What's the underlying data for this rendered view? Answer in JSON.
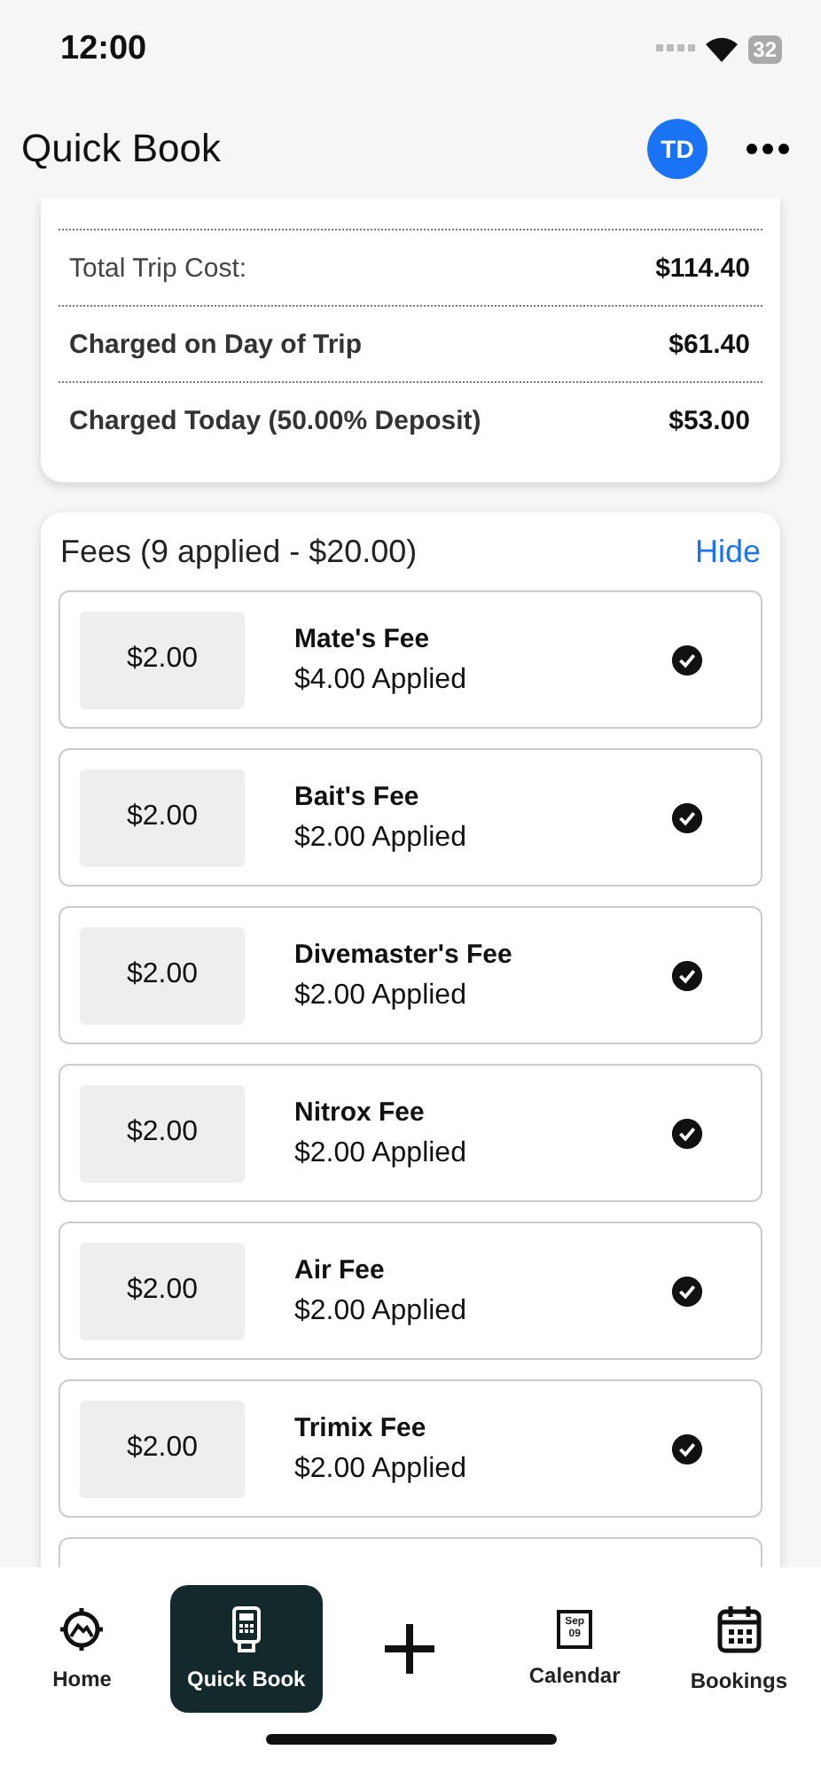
{
  "status_bar": {
    "time": "12:00",
    "battery": "32"
  },
  "header": {
    "title": "Quick Book",
    "avatar": "TD"
  },
  "summary": {
    "rows": [
      {
        "label": "Total Trip Cost:",
        "value": "$114.40",
        "kind": "plain"
      },
      {
        "label": "Charged on Day of Trip",
        "value": "$61.40",
        "kind": "bold"
      },
      {
        "label": "Charged Today (50.00% Deposit)",
        "value": "$53.00",
        "kind": "bold"
      }
    ]
  },
  "fees": {
    "title": "Fees (9 applied - $20.00)",
    "toggle": "Hide",
    "items": [
      {
        "price": "$2.00",
        "name": "Mate's Fee",
        "applied": "$4.00 Applied",
        "checked": true
      },
      {
        "price": "$2.00",
        "name": "Bait's Fee",
        "applied": "$2.00 Applied",
        "checked": true
      },
      {
        "price": "$2.00",
        "name": "Divemaster's Fee",
        "applied": "$2.00 Applied",
        "checked": true
      },
      {
        "price": "$2.00",
        "name": "Nitrox Fee",
        "applied": "$2.00 Applied",
        "checked": true
      },
      {
        "price": "$2.00",
        "name": "Air Fee",
        "applied": "$2.00 Applied",
        "checked": true
      },
      {
        "price": "$2.00",
        "name": "Trimix Fee",
        "applied": "$2.00 Applied",
        "checked": true
      }
    ]
  },
  "tab_bar": {
    "tabs": [
      {
        "label": "Home",
        "kind": "home",
        "selected": false
      },
      {
        "label": "Quick Book",
        "kind": "terminal",
        "selected": true
      },
      {
        "kind": "add",
        "selected": false
      },
      {
        "label": "Calendar",
        "kind": "date",
        "selected": false,
        "icon_lines": [
          "Sep",
          "09"
        ]
      },
      {
        "label": "Bookings",
        "kind": "calendar",
        "selected": false
      }
    ]
  }
}
